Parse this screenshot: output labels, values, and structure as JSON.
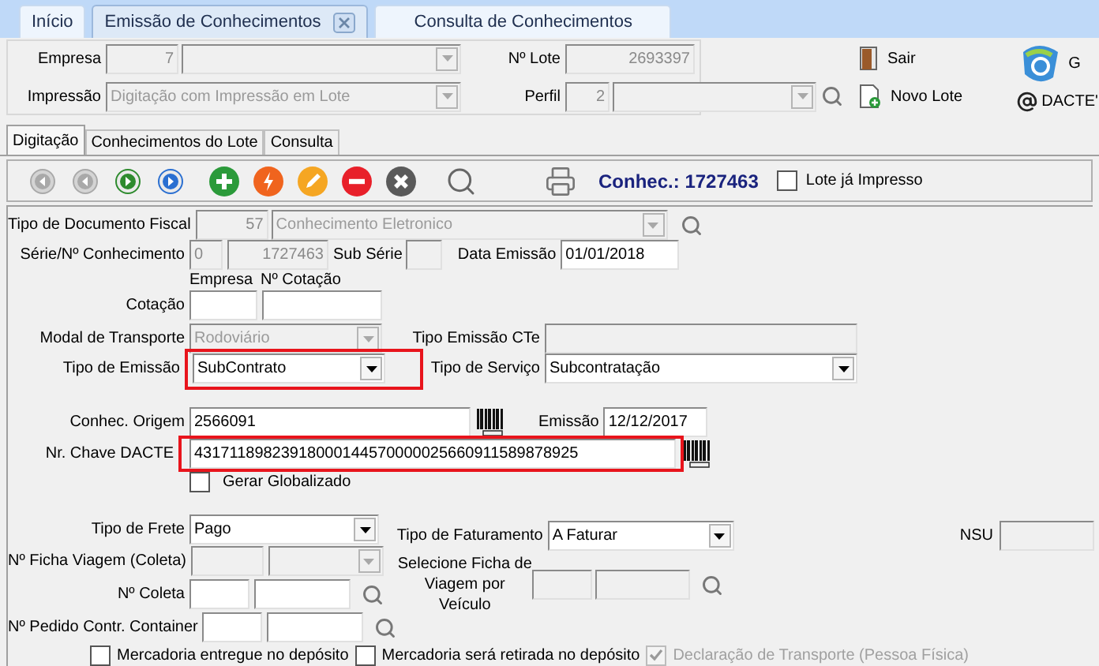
{
  "tabs": [
    {
      "label": "Início",
      "selected": false,
      "closable": false
    },
    {
      "label": "Emissão de Conhecimentos",
      "selected": true,
      "closable": true
    },
    {
      "label": "Consulta de Conhecimentos",
      "selected": false,
      "closable": false
    }
  ],
  "header": {
    "empresa": {
      "label": "Empresa",
      "code": "7"
    },
    "impressao": {
      "label": "Impressão",
      "value": "Digitação com Impressão em Lote"
    },
    "lote": {
      "label": "Nº Lote",
      "value": "2693397"
    },
    "perfil": {
      "label": "Perfil",
      "code": "2"
    },
    "actions": [
      {
        "label": "Sair",
        "kind": "exit"
      },
      {
        "label": "Novo Lote",
        "kind": "new"
      }
    ],
    "side": [
      {
        "label": "G",
        "kind": "logo"
      },
      {
        "label": "DACTE'",
        "kind": "at"
      }
    ]
  },
  "sub_tabs": [
    {
      "label": "Digitação",
      "selected": true
    },
    {
      "label": "Conhecimentos do Lote",
      "selected": false
    },
    {
      "label": "Consulta",
      "selected": false
    }
  ],
  "toolbar": {
    "buttons": [
      {
        "kind": "first",
        "disabled": true
      },
      {
        "kind": "prev",
        "disabled": true
      },
      {
        "kind": "next",
        "disabled": false
      },
      {
        "kind": "last",
        "disabled": false
      },
      {
        "kind": "add",
        "disabled": false
      },
      {
        "kind": "flash",
        "disabled": false
      },
      {
        "kind": "edit",
        "disabled": false
      },
      {
        "kind": "remove",
        "disabled": false
      },
      {
        "kind": "cancel",
        "disabled": false
      },
      {
        "kind": "search",
        "disabled": false
      },
      {
        "kind": "print",
        "disabled": false
      }
    ],
    "conhec_label": "Conhec.:",
    "conhec_number": "1727463",
    "lote_impresso": {
      "label": "Lote já Impresso",
      "checked": false
    }
  },
  "form": {
    "tipo_documento": {
      "label": "Tipo de Documento Fiscal",
      "code": "57",
      "value": "Conhecimento Eletronico"
    },
    "serie": {
      "label": "Série/Nº Conhecimento",
      "serie": "0",
      "numero": "1727463",
      "sub_serie_label": "Sub Série",
      "data_label": "Data Emissão",
      "data": "01/01/2018"
    },
    "cotacao_headers": [
      "Empresa",
      "Nº Cotação"
    ],
    "cotacao": {
      "label": "Cotação"
    },
    "modal": {
      "label": "Modal de Transporte",
      "value": "Rodoviário",
      "cte_label": "Tipo Emissão CTe"
    },
    "tipo_emissao": {
      "label": "Tipo de Emissão",
      "value": "SubContrato",
      "highlighted": true,
      "servico_label": "Tipo de Serviço",
      "servico": "Subcontratação"
    },
    "origem": {
      "label": "Conhec. Origem",
      "value": "2566091",
      "emissao_label": "Emissão",
      "emissao": "12/12/2017"
    },
    "chave": {
      "label": "Nr. Chave DACTE",
      "value": "43171189823918000144570000025660911589878925",
      "highlighted": true
    },
    "globalizado": {
      "label": "Gerar Globalizado",
      "checked": false
    },
    "frete": {
      "label": "Tipo de Frete",
      "value": "Pago"
    },
    "ficha": {
      "label": "Nº Ficha Viagem (Coleta)"
    },
    "coleta": {
      "label": "Nº Coleta"
    },
    "container": {
      "label": "Nº Pedido Contr. Container"
    },
    "faturamento": {
      "label": "Tipo de Faturamento",
      "value": "A Faturar"
    },
    "nsu": {
      "label": "NSU"
    },
    "ficha_veiculo": {
      "label": "Selecione Ficha de Viagem por Veículo"
    },
    "checks": [
      {
        "label": "Mercadoria entregue no depósito",
        "checked": false,
        "disabled": false
      },
      {
        "label": "Mercadoria será retirada no depósito",
        "checked": false,
        "disabled": false
      },
      {
        "label": "Declaração de Transporte (Pessoa Física)",
        "checked": true,
        "disabled": true
      }
    ]
  }
}
